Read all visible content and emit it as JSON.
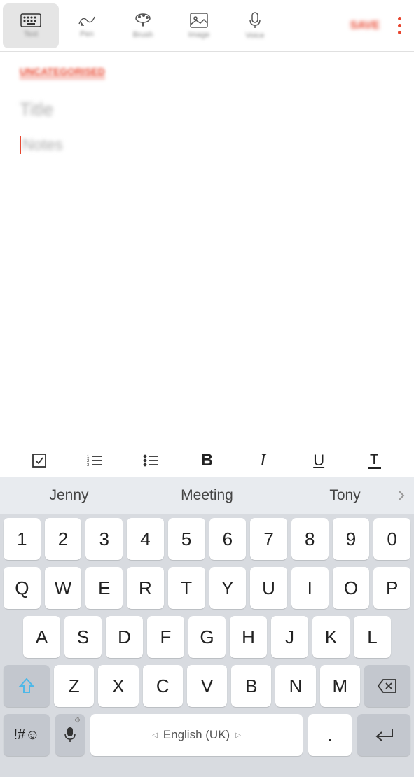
{
  "toolbar": {
    "items": [
      {
        "label": "Text",
        "icon": "keyboard"
      },
      {
        "label": "Pen",
        "icon": "pen"
      },
      {
        "label": "Brush",
        "icon": "brush"
      },
      {
        "label": "Image",
        "icon": "image"
      },
      {
        "label": "Voice",
        "icon": "voice"
      }
    ],
    "save_label": "SAVE"
  },
  "content": {
    "category": "UNCATEGORISED",
    "title_placeholder": "Title",
    "notes_placeholder": "Notes"
  },
  "format": {
    "bold": "B",
    "italic": "I",
    "underline": "U"
  },
  "keyboard": {
    "suggestions": [
      "Jenny",
      "Meeting",
      "Tony"
    ],
    "row_num": [
      "1",
      "2",
      "3",
      "4",
      "5",
      "6",
      "7",
      "8",
      "9",
      "0"
    ],
    "row1": [
      "Q",
      "W",
      "E",
      "R",
      "T",
      "Y",
      "U",
      "I",
      "O",
      "P"
    ],
    "row2": [
      "A",
      "S",
      "D",
      "F",
      "G",
      "H",
      "J",
      "K",
      "L"
    ],
    "row3": [
      "Z",
      "X",
      "C",
      "V",
      "B",
      "N",
      "M"
    ],
    "sym": "!#☺",
    "space": "English (UK)",
    "period": "."
  }
}
